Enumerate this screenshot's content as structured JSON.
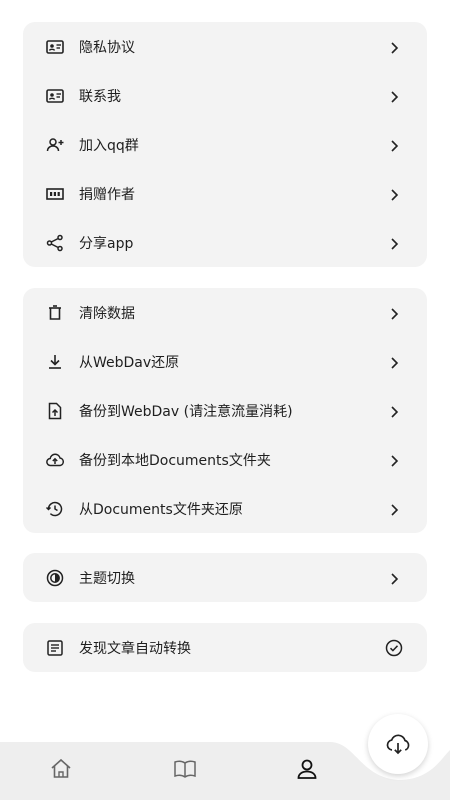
{
  "groups": [
    {
      "items": [
        {
          "label": "隐私协议",
          "icon": "id-card-icon"
        },
        {
          "label": "联系我",
          "icon": "id-card-icon"
        },
        {
          "label": "加入qq群",
          "icon": "add-group-icon"
        },
        {
          "label": "捐赠作者",
          "icon": "donate-icon"
        },
        {
          "label": "分享app",
          "icon": "share-icon"
        }
      ]
    },
    {
      "items": [
        {
          "label": "清除数据",
          "icon": "trash-icon"
        },
        {
          "label": "从WebDav还原",
          "icon": "download-icon"
        },
        {
          "label": "备份到WebDav (请注意流量消耗)",
          "icon": "file-upload-icon"
        },
        {
          "label": "备份到本地Documents文件夹",
          "icon": "cloud-upload-icon"
        },
        {
          "label": "从Documents文件夹还原",
          "icon": "restore-icon"
        }
      ]
    },
    {
      "items": [
        {
          "label": "主题切换",
          "icon": "theme-icon"
        }
      ]
    },
    {
      "items": [
        {
          "label": "发现文章自动转换",
          "icon": "article-icon",
          "checked": true
        }
      ]
    }
  ],
  "bottom_nav": {
    "tabs": [
      {
        "icon": "home-icon"
      },
      {
        "icon": "book-icon"
      },
      {
        "icon": "profile-icon",
        "active": true
      }
    ],
    "fab_icon": "cloud-download-icon"
  },
  "colors": {
    "card_bg": "#f3f3f3",
    "bar_bg": "#eeeeee",
    "text": "#1f1f1f"
  }
}
